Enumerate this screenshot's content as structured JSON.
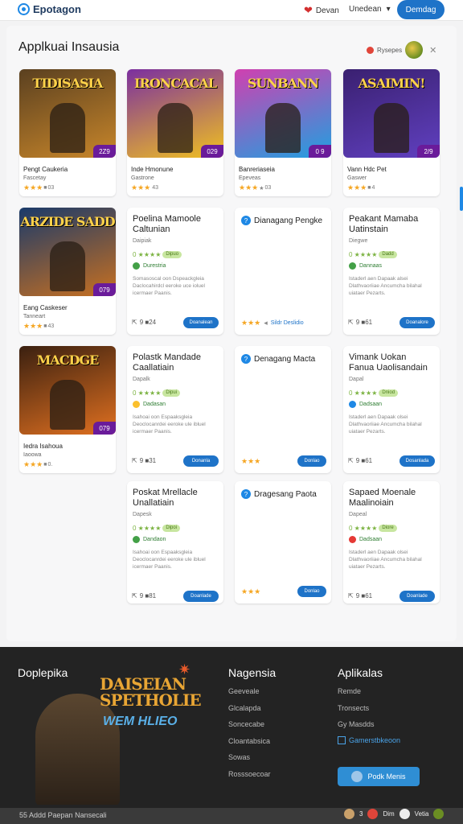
{
  "header": {
    "brand": "Epotagon",
    "user": "Devan",
    "menu_label": "Unedean",
    "menu_chevron": "▾",
    "cta": "Demdag"
  },
  "page": {
    "title": "Applkuai Insausia",
    "sort_label": "Rysepes"
  },
  "game_cards": [
    {
      "art_title": "TIDISASIA",
      "badge": "2Z9",
      "name": "Pengt Caukeria",
      "sub": "Fascetay",
      "stars": "★★★",
      "empty": "■",
      "count": "03",
      "colors": [
        "#5a4020",
        "#c8862a"
      ]
    },
    {
      "art_title": "IRONCACAL",
      "badge": "029",
      "name": "Inde Hmonune",
      "sub": "Gastrone",
      "stars": "★★★",
      "empty": "",
      "count": "43",
      "colors": [
        "#7b2fa0",
        "#f0c020"
      ]
    },
    {
      "art_title": "SUNBANN",
      "badge": "0 9",
      "name": "Banreriaseia",
      "sub": "Epeveas",
      "stars": "★★★",
      "empty": "★",
      "count": "03",
      "colors": [
        "#d040b0",
        "#20a0e0"
      ]
    },
    {
      "art_title": "ASAIMIN!",
      "badge": "2/9",
      "name": "Vann Hdc Pet",
      "sub": "Gaswer",
      "stars": "★★★",
      "empty": "■",
      "count": "4",
      "colors": [
        "#3a2070",
        "#6040c0"
      ]
    },
    {
      "art_title": "ARZIDE SADD",
      "badge": "079",
      "name": "Eang Caskeser",
      "sub": "Tanneart",
      "stars": "★★★",
      "empty": "■",
      "count": "43",
      "colors": [
        "#1a3a6a",
        "#c87020"
      ]
    },
    {
      "art_title": "MACDGE",
      "badge": "079",
      "name": "Iedra Isahoua",
      "sub": "Iaoowa",
      "stars": "★★★",
      "empty": "■",
      "count": "0.",
      "colors": [
        "#3a2010",
        "#e07020"
      ]
    }
  ],
  "detail_cards": [
    {
      "title": "Poelina Mamoole Caltunian",
      "tag": "Daipiak",
      "rating": "0 ★★★★",
      "pill": "Dipuo",
      "dev": "Durestria",
      "desc": "Somasoscal oon Dspeackgleia Daclocahirdcl eeroke uce ioluel icermaer Paanis.",
      "meta": "9 ■24",
      "btn": "Doanalean",
      "dev_color": "#43a047"
    },
    {
      "title": "Peakant Mamaba Uatinstain",
      "tag": "Diegwe",
      "rating": "0 ★★★★",
      "pill": "Dadd",
      "dev": "Dannaas",
      "desc": "Istaderl aen Dapaak alsei Dlathvaoriiae Ancumcha bilahal uiataer Pezarts.",
      "meta": "9 ■61",
      "btn": "Doanalore",
      "dev_color": "#43a047"
    },
    {
      "title": "Polastk Mandade Caallatiain",
      "tag": "Dapalk",
      "rating": "0 ★★★★",
      "pill": "Dipui",
      "dev": "Dadasan",
      "desc": "Isahoai oon Espaaksgleia Deoclocanrdei eeroke ule ibluel icermaer Paanis.",
      "meta": "9 ■31",
      "btn": "Donanla",
      "dev_color": "#fbc02d"
    },
    {
      "title": "Vimank Uokan Fanua Uaolisandain",
      "tag": "Dapal",
      "rating": "0 ★★★★",
      "pill": "Dniod",
      "dev": "Dadsaan",
      "desc": "Istaderl aen Dapaak olsei Dlathvaoriiae Ancumcha bilahal uiataer Pezarts.",
      "meta": "9 ■61",
      "btn": "Dosanlada",
      "dev_color": "#1e88e5"
    },
    {
      "title": "Poskat Mrellacle Unallatiain",
      "tag": "Dapesk",
      "rating": "0 ★★★★",
      "pill": "Dipoi",
      "dev": "Dandaon",
      "desc": "Isahoai oon Espaaksgleia Deoclocanrdei eeroke ule ibluel icermaer Paanis.",
      "meta": "9 ■81",
      "btn": "Doanlade",
      "dev_color": "#43a047"
    },
    {
      "title": "Sapaed Moenale Maalinoiain",
      "tag": "Dapeal",
      "rating": "0 ★★★★",
      "pill": "Diore",
      "dev": "Dadsaan",
      "desc": "Istaderl aen Dapaak olsei Dlathvaoriiae Ancumcha bilahal uiataer Pezarts.",
      "meta": "9 ■61",
      "btn": "Doanlade",
      "dev_color": "#e53935"
    }
  ],
  "question_cards": [
    {
      "title": "Dianagang Pengke",
      "stars": "★★★",
      "link": "Sildr Deslidio"
    },
    {
      "title": "Denagang Macta",
      "stars": "★★★",
      "btn": "Donlao"
    },
    {
      "title": "Dragesang Paota",
      "stars": "★★★",
      "btn": "Donlao"
    }
  ],
  "footer": {
    "brand_heading": "Doplepika",
    "hero_title": "DAISEIAN SPETHOLIE",
    "hero_sub": "WEM HLIEO",
    "col1_heading": "Nagensia",
    "col1_links": [
      "Geeveale",
      "Glcalapda",
      "Soncecabe",
      "Cloantabsica",
      "Sowas",
      "Rosssoecoar"
    ],
    "col2_heading": "Aplikalas",
    "col2_links": [
      "Remde",
      "Tronsects",
      "Gy Masdds"
    ],
    "box_link": "Gamerstbkeoon",
    "button": "Podk Menis",
    "copyright": "55 Addd Paepan Nansecali",
    "social_count": "3",
    "social_labels": [
      "Dim",
      "Vetia"
    ]
  },
  "icons": {
    "brand": "globe-logo-icon",
    "heart": "heart-icon",
    "question": "help-circle-icon",
    "star": "star-icon",
    "profile": "avatar-icon"
  },
  "colors": {
    "accent": "#1e73c8",
    "footer_bg": "#232323",
    "star": "#f5a623",
    "badge": "#6a1b9a"
  }
}
